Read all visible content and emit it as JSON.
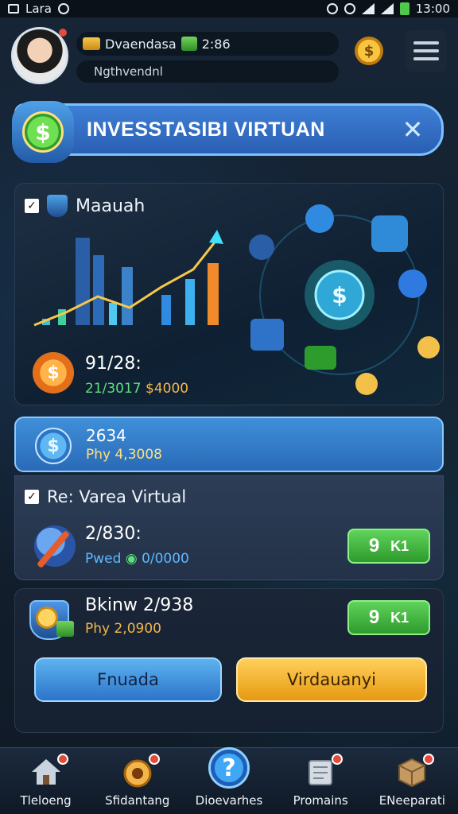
{
  "status_bar": {
    "carrier": "Lara",
    "time": "13:00"
  },
  "header": {
    "username": "Dvaendasa",
    "balance": "2:86",
    "subtitle": "Ngthvendnl"
  },
  "banner": {
    "title": "INVESSTASIBI VIRTUAN"
  },
  "main_panel": {
    "label": "Maauah",
    "value_primary": "91/28:",
    "value_secondary": "21/3017",
    "value_secondary_gold": "$4000"
  },
  "highlight_row": {
    "value_primary": "2634",
    "value_secondary": "Phy 4,3008"
  },
  "panel_two": {
    "label": "Re: Varea Virtual",
    "value_primary": "2/830:",
    "value_secondary_a": "Pwed",
    "value_secondary_b": "0/0000",
    "button_label": "9",
    "button_sub": "K1"
  },
  "panel_three": {
    "value_primary": "Bkinw 2/938",
    "value_secondary": "Phy 2,0900",
    "button_label": "9",
    "button_sub": "K1",
    "btn_left": "Fnuada",
    "btn_right": "Virdauanyi"
  },
  "bottom_nav": [
    {
      "label": "Tleloeng",
      "icon": "home-icon"
    },
    {
      "label": "Sfidantang",
      "icon": "medal-icon"
    },
    {
      "label": "Dioevarhes",
      "icon": "help-icon"
    },
    {
      "label": "Promains",
      "icon": "receipt-icon"
    },
    {
      "label": "ENeeparati",
      "icon": "box-icon"
    }
  ],
  "colors": {
    "accent_blue": "#3e7fd6",
    "green": "#5fd35a",
    "gold": "#f3b64a"
  }
}
